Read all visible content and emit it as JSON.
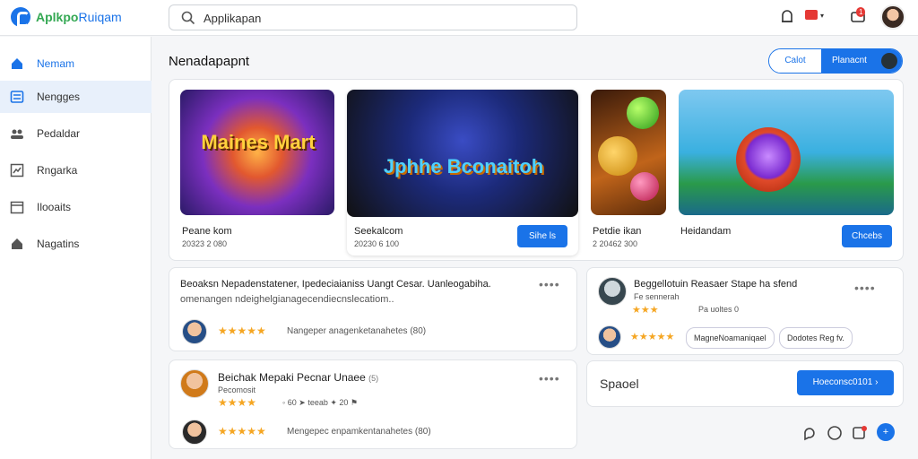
{
  "app": {
    "name_prefix": "Aplkpo",
    "name_suffix": "Ruiqam"
  },
  "search": {
    "value": "Applikapan"
  },
  "sidebar": {
    "items": [
      {
        "label": "Nemam",
        "icon": "home-icon"
      },
      {
        "label": "Nengges",
        "icon": "list-icon"
      },
      {
        "label": "Pedaldar",
        "icon": "people-icon"
      },
      {
        "label": "Rngarka",
        "icon": "chart-icon"
      },
      {
        "label": "Ilooaits",
        "icon": "calendar-icon"
      },
      {
        "label": "Nagatins",
        "icon": "home-outline-icon"
      }
    ]
  },
  "main": {
    "title": "Nenadapapnt",
    "segmented": {
      "left": "Calot",
      "right": "Planacnt"
    }
  },
  "games": [
    {
      "art": "Maines Mart",
      "label": "Peane kom",
      "sub": "20323 2 080"
    },
    {
      "art": "Jphhe Bconaitoh",
      "label": "Seekalcom",
      "sub": "20230 6 100",
      "button": "Sihe ls"
    },
    {
      "art": "",
      "label": "Petdie ikan",
      "sub": "2 20462 300"
    },
    {
      "art": "",
      "label": "Heidandam",
      "sub": "",
      "button": "Chcebs"
    }
  ],
  "reviews": [
    {
      "line1": "Beoaksn Nepadenstatener, Ipedeciaianiss Uangt Cesar. Uanleogabiha.",
      "line2": "omenangen ndeighelgianagecendiecnslecatiom..",
      "stars": "★★★★★",
      "caption": "Nangeper anagenketanahetes (80)"
    },
    {
      "title": "Beichak Mepaki Pecnar Unaee",
      "count": "(5)",
      "sub": "Pecomosit",
      "meta1": "60",
      "meta2": "teeab",
      "meta3": "20",
      "stars": "★★★★",
      "caption": "Mengepec enpamkentanahetes (80)"
    }
  ],
  "side_review": {
    "title": "Beggellotuin Reasaer Stape ha sfend",
    "sub": "Fe sennerah",
    "meta": "Pa uoltes 0",
    "stars": "★★★",
    "reply_stars": "★★★★★",
    "reply_name": "MagneNoamaniqael",
    "pill": "Dodotes Reg fv."
  },
  "panel": {
    "label": "Spaoel",
    "button": "Hoeconsc0101"
  },
  "colors": {
    "accent": "#1a73e8",
    "star": "#f5a623",
    "badge": "#e53935"
  }
}
